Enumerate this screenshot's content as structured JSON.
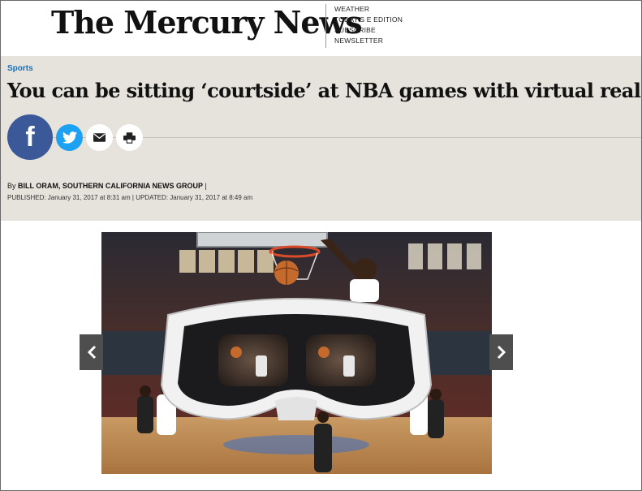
{
  "masthead": {
    "logo": "The Mercury News",
    "links": [
      "WEATHER",
      "TODAY'S E EDITION",
      "SUBSCRIBE",
      "NEWSLETTER"
    ]
  },
  "article": {
    "section": "Sports",
    "headline": "You can be sitting ‘courtside’ at NBA games with virtual reality",
    "byline_prefix": "By ",
    "author": "BILL ORAM, SOUTHERN CALIFORNIA NEWS GROUP",
    "byline_suffix": " |",
    "published_label": "PUBLISHED:",
    "published": " January 31, 2017 at 8:31 am",
    "separator": " | ",
    "updated_label": "UPDATED:",
    "updated": " January 31, 2017 at 8:49 am"
  },
  "share": {
    "icons": [
      "facebook-icon",
      "twitter-icon",
      "email-icon",
      "print-icon"
    ],
    "facebook_glyph": "f"
  },
  "gallery": {
    "arrows": [
      "chevron-left-icon",
      "chevron-right-icon"
    ]
  },
  "colors": {
    "section": "#1b6eb5",
    "band": "#e6e2dc",
    "facebook": "#3b5998",
    "twitter": "#1da1f2"
  }
}
